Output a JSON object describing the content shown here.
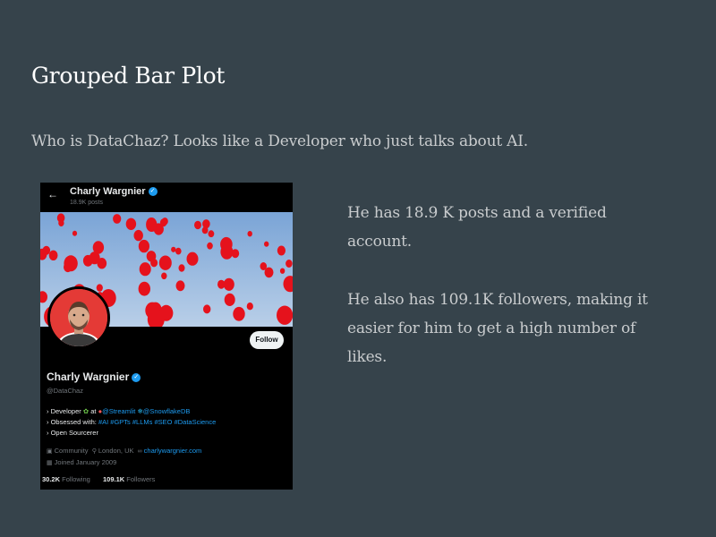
{
  "slide": {
    "title": "Grouped Bar Plot",
    "subtitle": "Who is DataChaz? Looks like a Developer who just talks about AI.",
    "paragraph1": "He has 18.9 K posts and a verified account.",
    "paragraph2": "He also has 109.1K followers, making it easier for him to get a high number of likes."
  },
  "profile": {
    "top_name": "Charly Wargnier",
    "posts_count": "18.9K posts",
    "follow_label": "Follow",
    "display_name": "Charly Wargnier",
    "handle": "@DataChaz",
    "bio": {
      "line1_prefix": "› Developer",
      "line1_at": "at",
      "line1_link1": "@Streamlit",
      "line1_link2": "@SnowflakeDB",
      "line2_prefix": "› Obsessed with:",
      "line2_tags": "#AI #GPTs #LLMs #SEO #DataScience",
      "line3": "› Open Sourcerer"
    },
    "meta": {
      "community": "Community",
      "location": "London, UK",
      "website": "charlywargnier.com",
      "joined": "Joined January 2009"
    },
    "following_count": "30.2K",
    "following_label": "Following",
    "followers_count": "109.1K",
    "followers_label": "Followers",
    "icons": [
      "back-arrow-icon",
      "verified-badge-icon",
      "community-icon",
      "location-icon",
      "link-icon",
      "calendar-icon"
    ]
  }
}
